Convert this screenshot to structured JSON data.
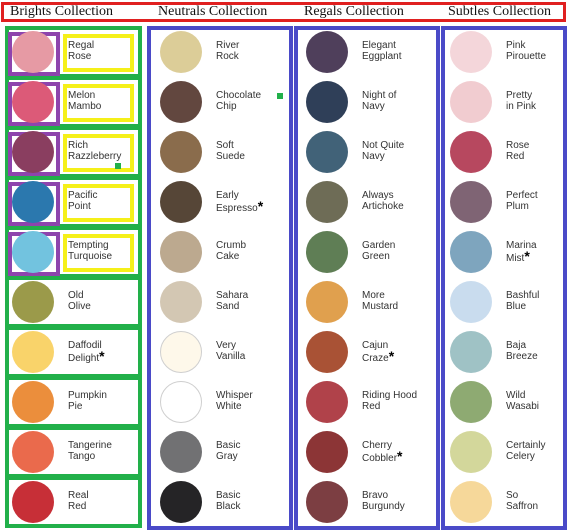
{
  "columns": [
    {
      "title": "Brights Collection",
      "items": [
        {
          "name": "Regal\nRose",
          "color": "#e69aa4",
          "star": false
        },
        {
          "name": "Melon\nMambo",
          "color": "#dc5a78",
          "star": false
        },
        {
          "name": "Rich\nRazzleberry",
          "color": "#8a3e60",
          "star": false
        },
        {
          "name": "Pacific\nPoint",
          "color": "#2b78ae",
          "star": false
        },
        {
          "name": "Tempting\nTurquoise",
          "color": "#72c3df",
          "star": false
        },
        {
          "name": "Old\nOlive",
          "color": "#9b9a4a",
          "star": false
        },
        {
          "name": "Daffodil\nDelight",
          "color": "#f9d36a",
          "star": true
        },
        {
          "name": "Pumpkin\nPie",
          "color": "#eb8e3c",
          "star": false
        },
        {
          "name": "Tangerine\nTango",
          "color": "#ea6a4c",
          "star": false
        },
        {
          "name": "Real\nRed",
          "color": "#c72f37",
          "star": false
        }
      ]
    },
    {
      "title": "Neutrals Collection",
      "items": [
        {
          "name": "River\nRock",
          "color": "#dccd98",
          "star": false
        },
        {
          "name": "Chocolate\nChip",
          "color": "#62473f",
          "star": false
        },
        {
          "name": "Soft\nSuede",
          "color": "#8a6c4c",
          "star": false
        },
        {
          "name": "Early\nEspresso",
          "color": "#564637",
          "star": true
        },
        {
          "name": "Crumb\nCake",
          "color": "#bca98f",
          "star": false
        },
        {
          "name": "Sahara\nSand",
          "color": "#d3c7b3",
          "star": false
        },
        {
          "name": "Very\nVanilla",
          "color": "#fef8ea",
          "star": false
        },
        {
          "name": "Whisper\nWhite",
          "color": "#ffffff",
          "star": false
        },
        {
          "name": "Basic\nGray",
          "color": "#717173",
          "star": false
        },
        {
          "name": "Basic\nBlack",
          "color": "#252426",
          "star": false
        }
      ]
    },
    {
      "title": "Regals Collection",
      "items": [
        {
          "name": "Elegant\nEggplant",
          "color": "#4f3f5b",
          "star": false
        },
        {
          "name": "Night of\nNavy",
          "color": "#2f3f58",
          "star": false
        },
        {
          "name": "Not Quite\nNavy",
          "color": "#416278",
          "star": false
        },
        {
          "name": "Always\nArtichoke",
          "color": "#6e6c56",
          "star": false
        },
        {
          "name": "Garden\nGreen",
          "color": "#5f7e55",
          "star": false
        },
        {
          "name": "More\nMustard",
          "color": "#e0a04e",
          "star": false
        },
        {
          "name": "Cajun\nCraze",
          "color": "#a95235",
          "star": true
        },
        {
          "name": "Riding Hood\nRed",
          "color": "#b0424a",
          "star": false
        },
        {
          "name": "Cherry\nCobbler",
          "color": "#8c3536",
          "star": true
        },
        {
          "name": "Bravo\nBurgundy",
          "color": "#7c3e42",
          "star": false
        }
      ]
    },
    {
      "title": "Subtles Collection",
      "items": [
        {
          "name": "Pink\nPirouette",
          "color": "#f4d6da",
          "star": false
        },
        {
          "name": "Pretty\nin Pink",
          "color": "#f1ccd0",
          "star": false
        },
        {
          "name": "Rose\nRed",
          "color": "#b7485f",
          "star": false
        },
        {
          "name": "Perfect\nPlum",
          "color": "#7f6474",
          "star": false
        },
        {
          "name": "Marina\nMist",
          "color": "#7ea5be",
          "star": true
        },
        {
          "name": "Bashful\nBlue",
          "color": "#c9dcee",
          "star": false
        },
        {
          "name": "Baja\nBreeze",
          "color": "#9fc2c5",
          "star": false
        },
        {
          "name": "Wild\nWasabi",
          "color": "#8eaa72",
          "star": false
        },
        {
          "name": "Certainly\nCelery",
          "color": "#d3d79b",
          "star": false
        },
        {
          "name": "So\nSaffron",
          "color": "#f6d89a",
          "star": false
        }
      ]
    }
  ]
}
